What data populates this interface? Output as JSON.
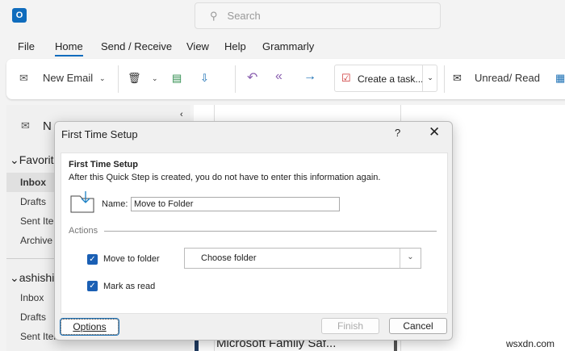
{
  "app": {
    "logo": "O",
    "search_placeholder": "Search"
  },
  "menu": [
    "File",
    "Home",
    "Send / Receive",
    "View",
    "Help",
    "Grammarly"
  ],
  "ribbon": {
    "new_email": "New Email",
    "create_task": "Create a task...",
    "unread_read": "Unread/ Read"
  },
  "nav": {
    "new": "N",
    "favorites": "Favorit",
    "fav_items": [
      "Inbox",
      "Drafts",
      "Sent Iter",
      "Archive"
    ],
    "account": "ashishi",
    "acct_items": [
      "Inbox",
      "Drafts",
      "Sent Iter"
    ]
  },
  "main": {
    "message_preview": "Microsoft Family Saf..."
  },
  "dialog": {
    "title": "First Time Setup",
    "help": "?",
    "heading": "First Time Setup",
    "description": "After this Quick Step is created, you do not have to enter this information again.",
    "name_label": "Name:",
    "name_value": "Move to Folder",
    "actions_label": "Actions",
    "action1": "Move to folder",
    "folder_select": "Choose folder",
    "action2": "Mark as read",
    "options": "Options",
    "finish": "Finish",
    "cancel": "Cancel"
  },
  "watermark": "wsxdn.com"
}
